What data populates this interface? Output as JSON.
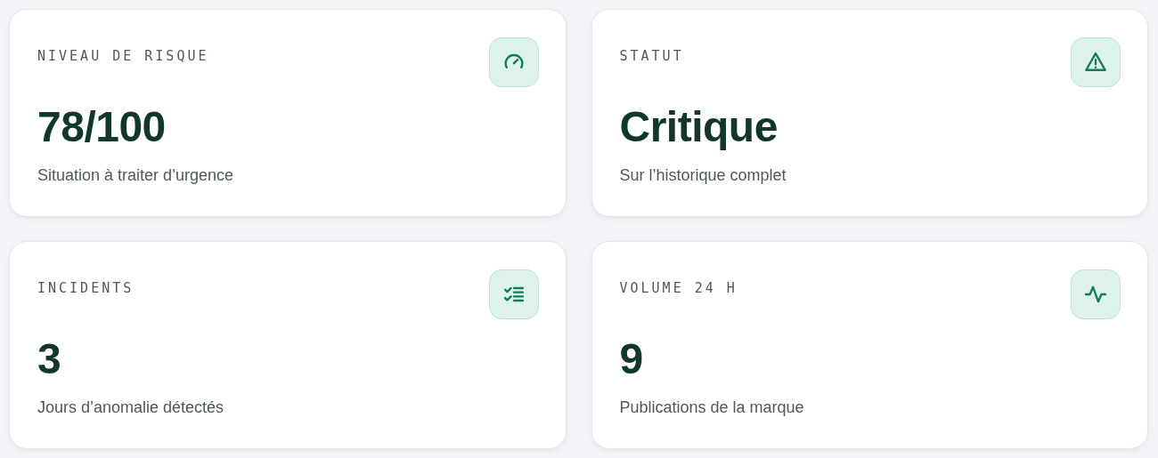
{
  "cards": [
    {
      "label": "NIVEAU DE RISQUE",
      "value": "78/100",
      "caption": "Situation à traiter d’urgence",
      "kind": "gauge"
    },
    {
      "label": "STATUT",
      "value": "Critique",
      "caption": "Sur l’historique complet",
      "kind": "alert"
    },
    {
      "label": "INCIDENTS",
      "value": "3",
      "caption": "Jours d’anomalie détectés",
      "kind": "checklist"
    },
    {
      "label": "VOLUME 24 H",
      "value": "9",
      "caption": "Publications de la marque",
      "kind": "pulse"
    }
  ]
}
